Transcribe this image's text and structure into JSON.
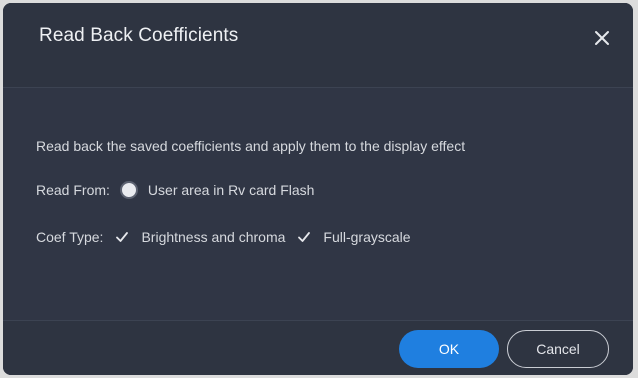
{
  "dialog": {
    "title": "Read Back Coefficients",
    "close_icon": "close-icon",
    "description": "Read back the saved coefficients and apply them to the display effect",
    "read_from": {
      "label": "Read From:",
      "option_label": "User area in Rv card Flash",
      "selected": true
    },
    "coef_type": {
      "label": "Coef Type:",
      "options": [
        {
          "label": "Brightness and chroma",
          "checked": true
        },
        {
          "label": "Full-grayscale",
          "checked": true
        }
      ]
    },
    "buttons": {
      "ok_label": "OK",
      "cancel_label": "Cancel"
    }
  },
  "colors": {
    "dialog_bg": "#2e3441",
    "accent_blue": "#1f7fe0",
    "text": "#d6d9de"
  }
}
